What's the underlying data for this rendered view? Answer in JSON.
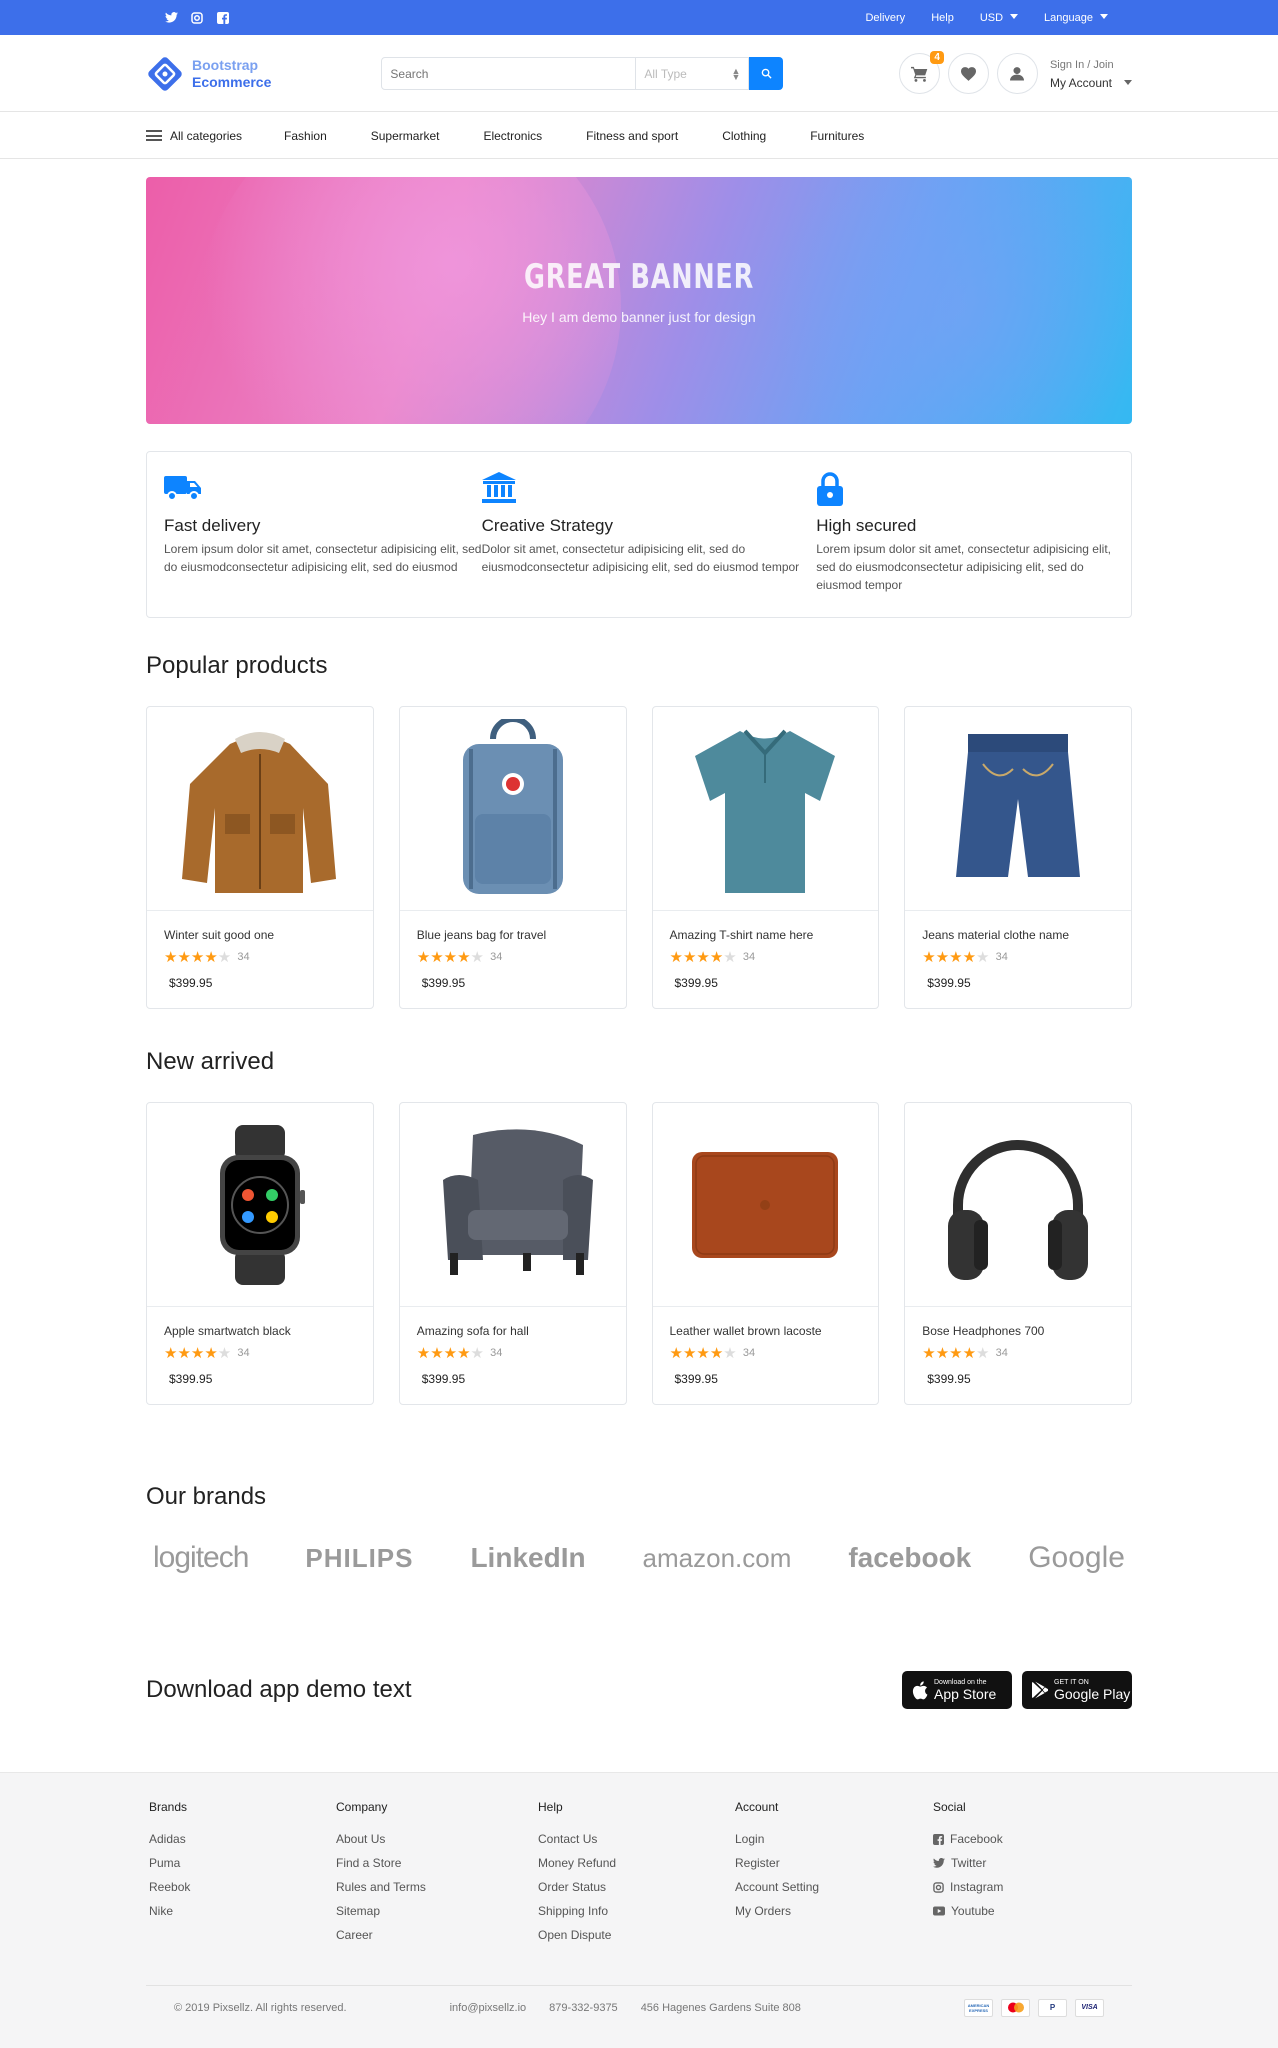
{
  "topbar": {
    "social_icons": [
      "twitter-icon",
      "instagram-icon",
      "facebook-icon"
    ],
    "links": [
      "Delivery",
      "Help",
      "USD",
      "Language"
    ]
  },
  "header": {
    "brand_line1": "Bootstrap",
    "brand_line2": "Ecommerce",
    "search_placeholder": "Search",
    "type_select": "All Type",
    "cart_count": "4",
    "signin": "Sign In / Join",
    "account": "My Account"
  },
  "nav": {
    "all": "All categories",
    "items": [
      "Fashion",
      "Supermarket",
      "Electronics",
      "Fitness and sport",
      "Clothing",
      "Furnitures"
    ]
  },
  "banner": {
    "title": "GREAT BANNER",
    "subtitle": "Hey I am demo banner just for design"
  },
  "features": [
    {
      "title": "Fast delivery",
      "text": "Lorem ipsum dolor sit amet, consectetur adipisicing elit, sed do eiusmodconsectetur adipisicing elit, sed do eiusmod",
      "icon": "truck-icon"
    },
    {
      "title": "Creative Strategy",
      "text": "Dolor sit amet, consectetur adipisicing elit, sed do eiusmodconsectetur adipisicing elit, sed do eiusmod tempor",
      "icon": "bank-icon"
    },
    {
      "title": "High secured",
      "text": "Lorem ipsum dolor sit amet, consectetur adipisicing elit, sed do eiusmodconsectetur adipisicing elit, sed do eiusmod tempor",
      "icon": "lock-icon"
    }
  ],
  "popular": {
    "title": "Popular products",
    "items": [
      {
        "name": "Winter suit good one",
        "reviews": "34",
        "price": "$399.95",
        "rating": 4
      },
      {
        "name": "Blue jeans bag for travel",
        "reviews": "34",
        "price": "$399.95",
        "rating": 4
      },
      {
        "name": "Amazing T-shirt name here",
        "reviews": "34",
        "price": "$399.95",
        "rating": 4
      },
      {
        "name": "Jeans material clothe name",
        "reviews": "34",
        "price": "$399.95",
        "rating": 4
      }
    ]
  },
  "new_arrived": {
    "title": "New arrived",
    "items": [
      {
        "name": "Apple smartwatch black",
        "reviews": "34",
        "price": "$399.95",
        "rating": 4
      },
      {
        "name": "Amazing sofa for hall",
        "reviews": "34",
        "price": "$399.95",
        "rating": 4
      },
      {
        "name": "Leather wallet brown lacoste",
        "reviews": "34",
        "price": "$399.95",
        "rating": 4
      },
      {
        "name": "Bose Headphones 700",
        "reviews": "34",
        "price": "$399.95",
        "rating": 4
      }
    ]
  },
  "brands": {
    "title": "Our brands",
    "items": [
      "logitech",
      "PHILIPS",
      "LinkedIn",
      "amazon.com",
      "facebook",
      "Google"
    ]
  },
  "app": {
    "title": "Download app demo text",
    "appstore_small": "Download on the",
    "appstore_big": "App Store",
    "gplay_small": "GET IT ON",
    "gplay_big": "Google Play"
  },
  "footer": {
    "cols": [
      {
        "title": "Brands",
        "items": [
          "Adidas",
          "Puma",
          "Reebok",
          "Nike"
        ]
      },
      {
        "title": "Company",
        "items": [
          "About Us",
          "Find a Store",
          "Rules and Terms",
          "Sitemap",
          "Career"
        ]
      },
      {
        "title": "Help",
        "items": [
          "Contact Us",
          "Money Refund",
          "Order Status",
          "Shipping Info",
          "Open Dispute"
        ]
      },
      {
        "title": "Account",
        "items": [
          "Login",
          "Register",
          "Account Setting",
          "My Orders"
        ]
      },
      {
        "title": "Social",
        "items": [
          "Facebook",
          "Twitter",
          "Instagram",
          "Youtube"
        ]
      }
    ],
    "copyright": "© 2019 Pixsellz. All rights reserved.",
    "email": "info@pixsellz.io",
    "phone": "879-332-9375",
    "address": "456 Hagenes Gardens Suite 808",
    "payment_cards": [
      "AMERICAN EXPRESS",
      "mastercard",
      "PayPal",
      "VISA"
    ]
  },
  "colors": {
    "primary": "#3d6fea",
    "accent": "#0d84ff",
    "star": "#ff9a12"
  }
}
